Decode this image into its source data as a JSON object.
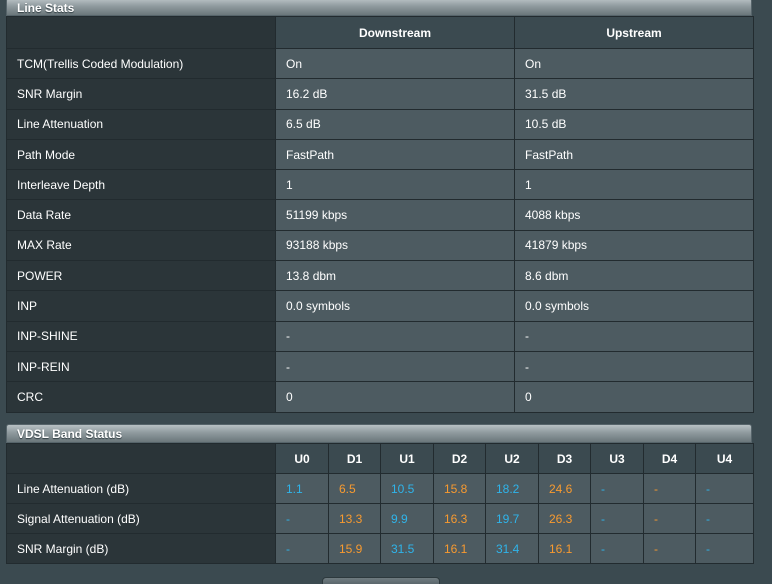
{
  "line_stats": {
    "title": "Line Stats",
    "columns": [
      "Downstream",
      "Upstream"
    ],
    "rows": [
      {
        "label": "TCM(Trellis Coded Modulation)",
        "down": "On",
        "up": "On"
      },
      {
        "label": "SNR Margin",
        "down": "16.2 dB",
        "up": "31.5 dB"
      },
      {
        "label": "Line Attenuation",
        "down": "6.5 dB",
        "up": "10.5 dB"
      },
      {
        "label": "Path Mode",
        "down": "FastPath",
        "up": "FastPath"
      },
      {
        "label": "Interleave Depth",
        "down": "1",
        "up": "1"
      },
      {
        "label": "Data Rate",
        "down": "51199 kbps",
        "up": "4088 kbps"
      },
      {
        "label": "MAX Rate",
        "down": "93188 kbps",
        "up": "41879 kbps"
      },
      {
        "label": "POWER",
        "down": "13.8 dbm",
        "up": "8.6 dbm"
      },
      {
        "label": "INP",
        "down": "0.0 symbols",
        "up": "0.0 symbols"
      },
      {
        "label": "INP-SHINE",
        "down": "-",
        "up": "-"
      },
      {
        "label": "INP-REIN",
        "down": "-",
        "up": "-"
      },
      {
        "label": "CRC",
        "down": "0",
        "up": "0"
      }
    ]
  },
  "band_status": {
    "title": "VDSL Band Status",
    "bands": [
      "U0",
      "D1",
      "U1",
      "D2",
      "U2",
      "D3",
      "U3",
      "D4",
      "U4"
    ],
    "rows": [
      {
        "label": "Line Attenuation (dB)",
        "values": [
          "1.1",
          "6.5",
          "10.5",
          "15.8",
          "18.2",
          "24.6",
          "-",
          "-",
          "-"
        ]
      },
      {
        "label": "Signal Attenuation (dB)",
        "values": [
          "-",
          "13.3",
          "9.9",
          "16.3",
          "19.7",
          "26.3",
          "-",
          "-",
          "-"
        ]
      },
      {
        "label": "SNR Margin (dB)",
        "values": [
          "-",
          "15.9",
          "31.5",
          "16.1",
          "31.4",
          "16.1",
          "-",
          "-",
          "-"
        ]
      }
    ]
  },
  "colors": {
    "upstream_band": "#2fb4ea",
    "downstream_band": "#f79a30"
  }
}
